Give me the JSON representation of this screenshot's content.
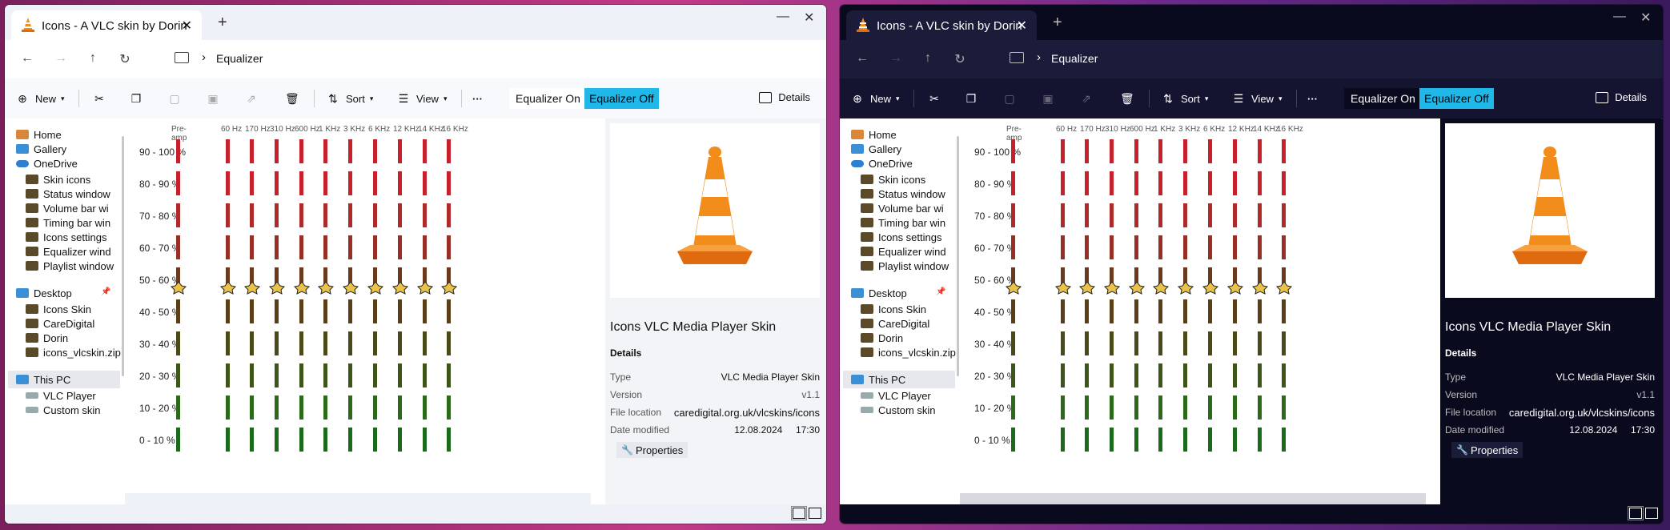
{
  "app": {
    "tab_title": "Icons - A VLC skin by Dorin",
    "tab_close": "✕",
    "new_tab": "+",
    "win_min": "—",
    "win_close": "✕"
  },
  "nav": {
    "back": "←",
    "forward": "→",
    "up": "↑",
    "refresh": "↻",
    "chevron": "›",
    "breadcrumb": "Equalizer"
  },
  "toolbar": {
    "new_label": "New",
    "sort_label": "Sort",
    "view_label": "View",
    "more_label": "···",
    "eq_on_label": "Equalizer On",
    "eq_off_label": "Equalizer Off",
    "details_label": "Details"
  },
  "sidebar": {
    "items": [
      {
        "label": "Home",
        "icon": "home-icon"
      },
      {
        "label": "Gallery",
        "icon": "gallery-icon"
      },
      {
        "label": "OneDrive",
        "icon": "cloud-icon"
      },
      {
        "label": "Skin icons",
        "icon": "folder-icon"
      },
      {
        "label": "Status window",
        "icon": "folder-icon"
      },
      {
        "label": "Volume bar wi",
        "icon": "folder-icon"
      },
      {
        "label": "Timing bar win",
        "icon": "folder-icon"
      },
      {
        "label": "Icons settings",
        "icon": "folder-icon"
      },
      {
        "label": "Equalizer wind",
        "icon": "folder-icon"
      },
      {
        "label": "Playlist window",
        "icon": "folder-icon"
      },
      {
        "label": "Desktop",
        "icon": "desktop-icon"
      },
      {
        "label": "Icons Skin",
        "icon": "folder-icon"
      },
      {
        "label": "CareDigital",
        "icon": "folder-icon"
      },
      {
        "label": "Dorin",
        "icon": "folder-icon"
      },
      {
        "label": "icons_vlcskin.zip",
        "icon": "zip-icon"
      },
      {
        "label": "This PC",
        "icon": "computer-icon"
      },
      {
        "label": "VLC Player",
        "icon": "drive-icon"
      },
      {
        "label": "Custom skin",
        "icon": "drive-icon"
      }
    ]
  },
  "equalizer": {
    "bands": [
      "Pre-amp",
      "60 Hz",
      "170 Hz",
      "310 Hz",
      "600 Hz",
      "1 KHz",
      "3 KHz",
      "6 KHz",
      "12 KHz",
      "14 KHz",
      "16 KHz"
    ],
    "levels": [
      "90 - 100 %",
      "80 - 90 %",
      "70 - 80 %",
      "60 - 70 %",
      "50 - 60 %",
      "40 - 50 %",
      "30 - 40 %",
      "20 - 30 %",
      "10 - 20 %",
      "0 - 10 %"
    ],
    "level_colors": [
      "#c8202a",
      "#c8202a",
      "#b02a2a",
      "#992e26",
      "#6b3a1c",
      "#5b3e18",
      "#4a4a18",
      "#3e5518",
      "#2a6a1a",
      "#1a6a1a"
    ],
    "slider_value_fraction": 0.5
  },
  "details": {
    "title": "Icons VLC Media Player Skin",
    "section": "Details",
    "type_label": "Type",
    "type_value": "VLC Media Player Skin",
    "version_label": "Version",
    "version_value": "v1.1",
    "location_label": "File location",
    "location_value": "caredigital.org.uk/vlcskins/icons",
    "date_label": "Date modified",
    "date_value": "12.08.2024     17:30",
    "properties_label": "Properties"
  }
}
